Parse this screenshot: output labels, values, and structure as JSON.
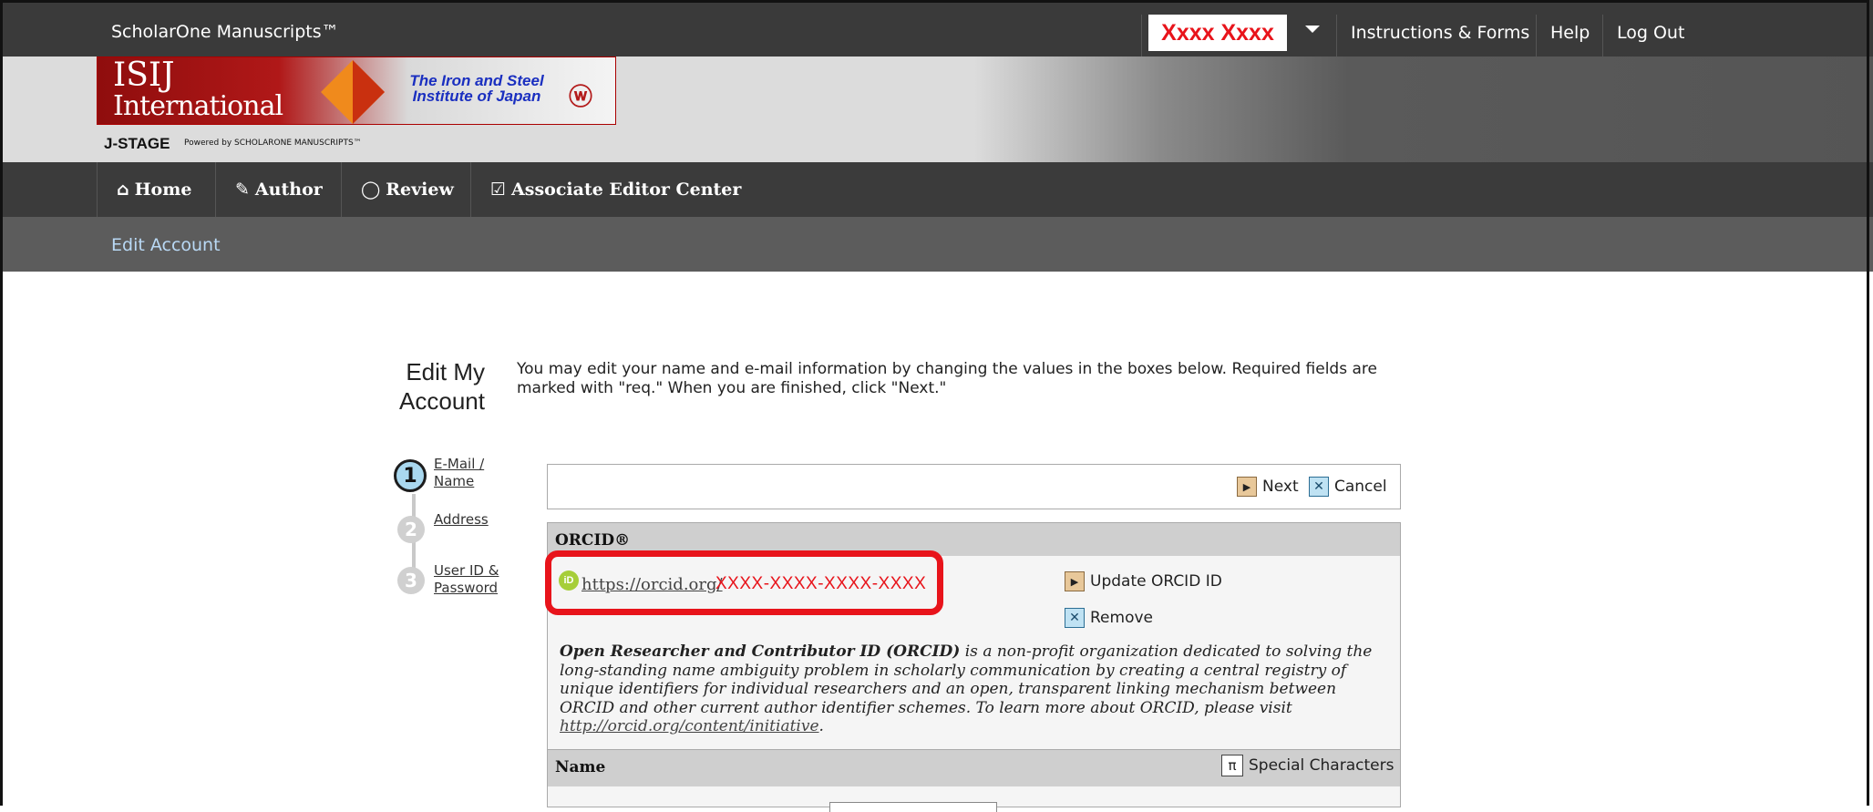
{
  "topbar": {
    "brand": "ScholarOne Manuscripts™",
    "user_name": "Xxxx Xxxx",
    "links": [
      "Instructions & Forms",
      "Help",
      "Log Out"
    ]
  },
  "banner": {
    "logo_line1": "ISIJ",
    "logo_line2": "International",
    "tagline": "The Iron and Steel Institute of Japan",
    "jstage": "J-STAGE",
    "powered": "Powered by SCHOLARONE MANUSCRIPTS™"
  },
  "nav": {
    "items": [
      {
        "label": "Home",
        "icon": "home-icon"
      },
      {
        "label": "Author",
        "icon": "pencil-icon"
      },
      {
        "label": "Review",
        "icon": "comment-icon"
      },
      {
        "label": "Associate Editor Center",
        "icon": "check-square-icon"
      }
    ]
  },
  "subnav": {
    "label": "Edit Account"
  },
  "page": {
    "title": "Edit My Account",
    "intro": "You may edit your name and e-mail information by changing the values in the boxes below. Required fields are marked with \"req.\" When you are finished, click \"Next.\""
  },
  "steps": [
    {
      "number": "1",
      "label": "E-Mail / Name",
      "active": true
    },
    {
      "number": "2",
      "label": "Address",
      "active": false
    },
    {
      "number": "3",
      "label": "User ID & Password",
      "active": false
    }
  ],
  "buttons": {
    "next": "Next",
    "cancel": "Cancel"
  },
  "orcid": {
    "header": "ORCID®",
    "url_prefix": "https://orcid.org/",
    "id_value": "XXXX-XXXX-XXXX-XXXX",
    "update_label": "Update ORCID ID",
    "remove_label": "Remove",
    "desc_bold": "Open Researcher and Contributor ID (ORCID)",
    "desc_rest": " is a non-profit organization dedicated to solving the long-standing name ambiguity problem in scholarly communication by creating a central registry of unique identifiers for individual researchers and an open, transparent linking mechanism between ORCID and other current author identifier schemes. To learn more about ORCID, please visit ",
    "desc_link": "http://orcid.org/content/initiative",
    "desc_end": "."
  },
  "name_section": {
    "header": "Name",
    "special_chars": "Special Characters"
  },
  "colors": {
    "highlight": "#e8141b",
    "nav_bg": "#3b3b3b",
    "link_blue": "#b9d9f5"
  }
}
